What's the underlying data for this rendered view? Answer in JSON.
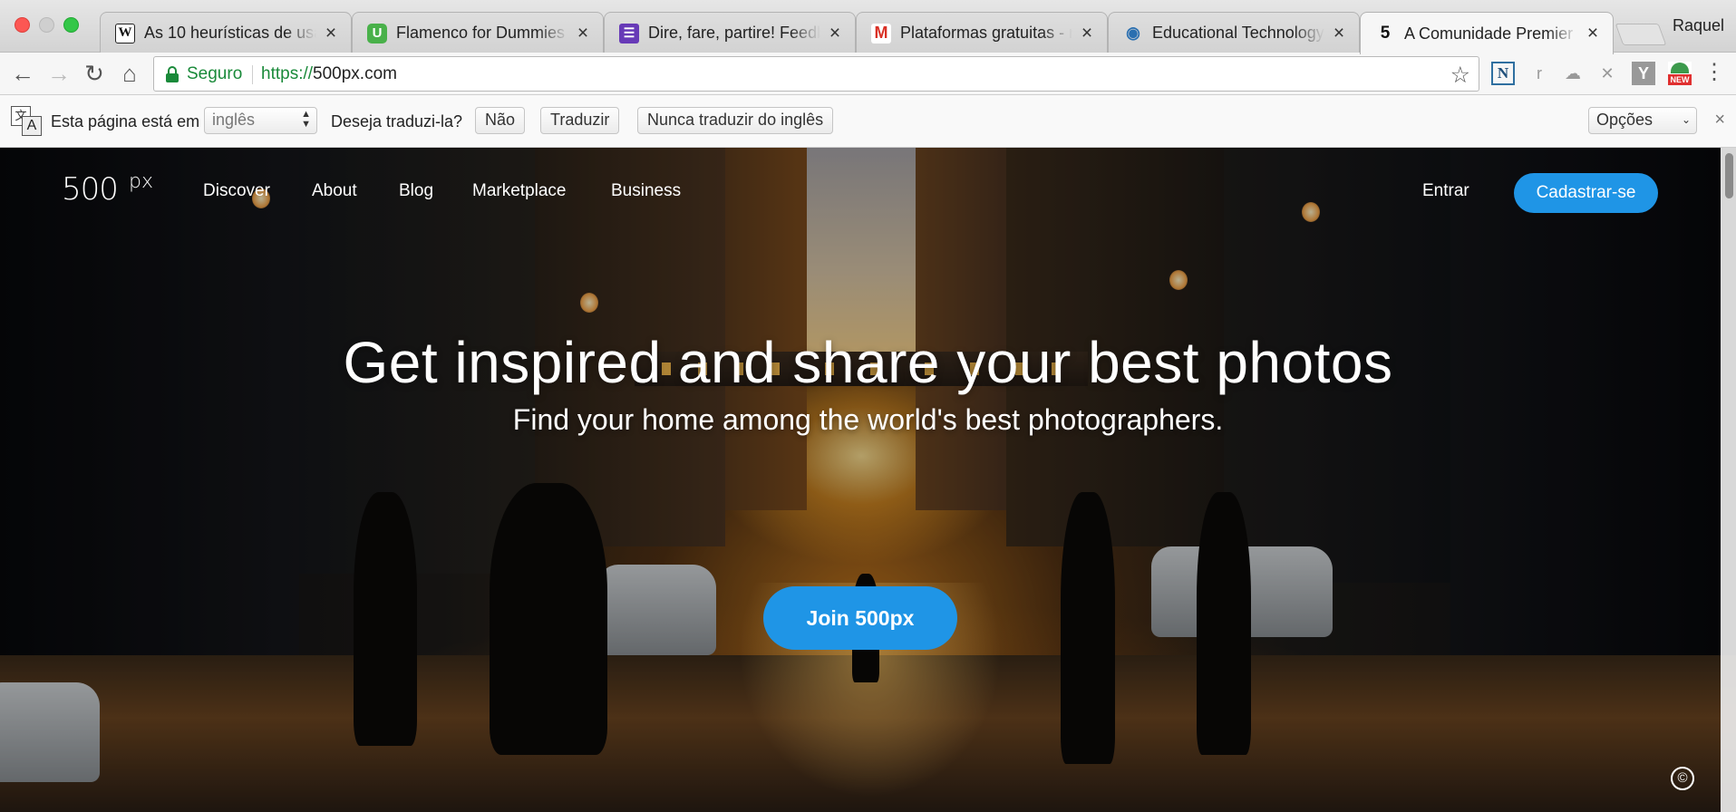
{
  "browser": {
    "tabs": [
      {
        "title": "As 10 heurísticas de usab",
        "favicon": "W"
      },
      {
        "title": "Flamenco for Dummies | V",
        "favicon": "U"
      },
      {
        "title": "Dire, fare, partire! Feedba",
        "favicon": "list"
      },
      {
        "title": "Plataformas gratuitas - ra",
        "favicon": "M"
      },
      {
        "title": "Educational Technology T",
        "favicon": "eye"
      },
      {
        "title": "A Comunidade Premier de",
        "favicon": "5"
      }
    ],
    "profile_name": "Raquel",
    "address": {
      "secure_label": "Seguro",
      "url_scheme": "https://",
      "url_host": "500px.com"
    },
    "extensions": {
      "n_label": "N",
      "r_label": "r",
      "y_label": "Y",
      "new_badge": "NEW"
    }
  },
  "translate_bar": {
    "prefix": "Esta página está em",
    "language": "inglês",
    "question": "Deseja traduzi-la?",
    "no_label": "Não",
    "translate_label": "Traduzir",
    "never_label": "Nunca traduzir do inglês",
    "options_label": "Opções"
  },
  "site": {
    "logo_text": "500px",
    "nav": [
      "Discover",
      "About",
      "Blog",
      "Marketplace",
      "Business"
    ],
    "login_label": "Entrar",
    "signup_label": "Cadastrar-se",
    "headline": "Get inspired and share your best photos",
    "subheadline": "Find your home among the world's best photographers.",
    "cta_label": "Join 500px",
    "copyright_symbol": "©"
  },
  "colors": {
    "accent": "#1f95e6",
    "secure_green": "#1a8a3a"
  }
}
